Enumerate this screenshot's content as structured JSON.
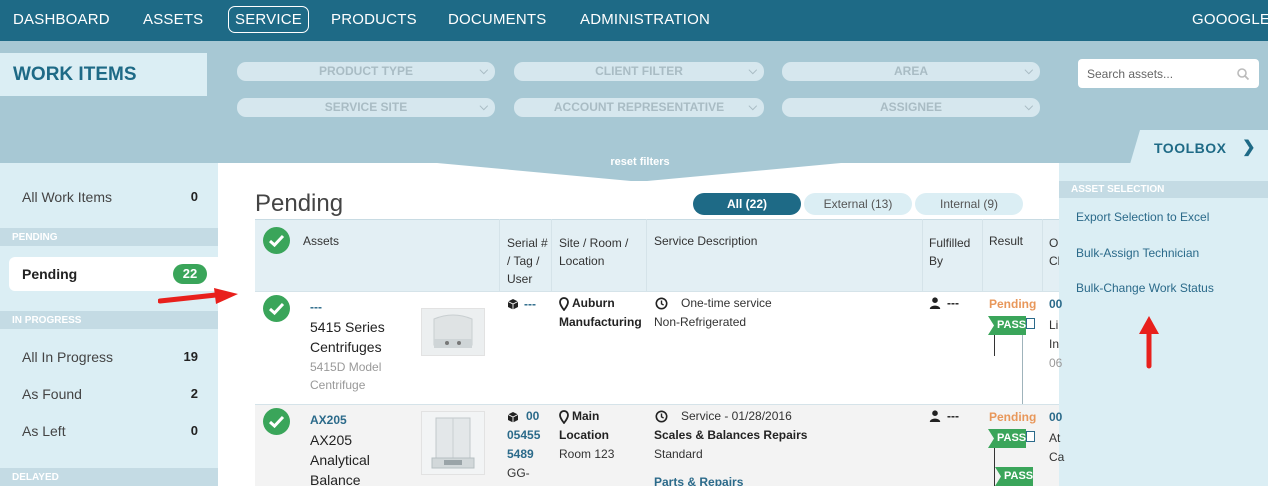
{
  "nav": {
    "items": [
      "DASHBOARD",
      "ASSETS",
      "SERVICE",
      "PRODUCTS",
      "DOCUMENTS",
      "ADMINISTRATION"
    ],
    "active": "SERVICE",
    "user": "GOOOGLE"
  },
  "page_title": "WORK ITEMS",
  "filters": {
    "product_type": "PRODUCT TYPE",
    "client_filter": "CLIENT FILTER",
    "area": "AREA",
    "service_site": "SERVICE SITE",
    "account_rep": "ACCOUNT REPRESENTATIVE",
    "assignee": "ASSIGNEE",
    "reset": "reset filters"
  },
  "search": {
    "placeholder": "Search assets..."
  },
  "toolbox": {
    "title": "TOOLBOX",
    "section": "ASSET SELECTION",
    "links": [
      "Export Selection to Excel",
      "Bulk-Assign Technician",
      "Bulk-Change Work Status"
    ]
  },
  "sidebar": {
    "all_work_items": {
      "label": "All Work Items",
      "count": "0"
    },
    "section_pending": "PENDING",
    "pending": {
      "label": "Pending",
      "count": "22"
    },
    "section_in_progress": "IN PROGRESS",
    "all_in_progress": {
      "label": "All In Progress",
      "count": "19"
    },
    "as_found": {
      "label": "As Found",
      "count": "2"
    },
    "as_left": {
      "label": "As Left",
      "count": "0"
    },
    "section_delayed": "DELAYED"
  },
  "main": {
    "title": "Pending",
    "tabs": {
      "all": "All (22)",
      "external": "External (13)",
      "internal": "Internal (9)"
    }
  },
  "table": {
    "headers": {
      "assets": "Assets",
      "serial": "Serial # / Tag / User",
      "site": "Site / Room / Location",
      "service": "Service Description",
      "fulfilled": "Fulfilled By",
      "result": "Result",
      "other": "O Cl"
    },
    "rows": [
      {
        "asset_link": "---",
        "asset_name": "5415 Series Centrifuges",
        "asset_model": "5415D Model Centrifuge",
        "serial_link": "---",
        "site_name": "Auburn Manufacturing",
        "service_type": "One-time service",
        "service_detail": "Non-Refrigerated",
        "fulfilled": "---",
        "result_status": "Pending",
        "pass_label": "PASS",
        "other": {
          "line1": "00",
          "line2": "Li",
          "line3": "In",
          "line4": "06"
        }
      },
      {
        "asset_link": "AX205",
        "asset_name": "AX205 Analytical Balance",
        "serial_line1": "00",
        "serial_line2": "05455",
        "serial_line3": "5489",
        "serial_line4": "GG-",
        "site_name": "Main Location",
        "site_room": "Room 123",
        "service_type": "Service - 01/28/2016",
        "service_name": "Scales & Balances Repairs",
        "service_detail": "Standard",
        "service_link": "Parts & Repairs",
        "fulfilled": "---",
        "result_status": "Pending",
        "pass_label": "PASS",
        "pass_label2": "PASS",
        "other": {
          "line1": "00",
          "line2": "At",
          "line3": "Ca"
        }
      }
    ]
  },
  "colors": {
    "nav": "#1e6a86",
    "band": "#a7c8d4",
    "panel": "#dbeef4",
    "accent_green": "#3aa55a",
    "pending_orange": "#e8975a",
    "annotation_red": "#e8201c"
  }
}
